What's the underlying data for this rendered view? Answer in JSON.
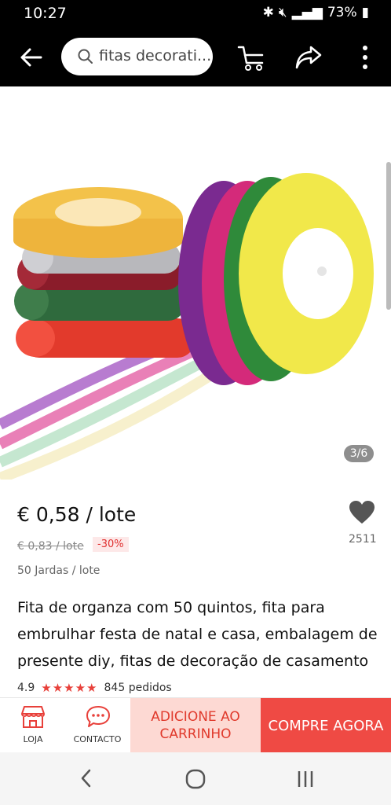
{
  "status": {
    "time": "10:27",
    "battery": "73%"
  },
  "search": {
    "query": "fitas decorati..."
  },
  "icons": {
    "back": "arrow-left-icon",
    "search": "search-icon",
    "cart": "cart-icon",
    "share": "share-icon",
    "more": "more-vertical-icon",
    "wishlist": "heart-icon",
    "store": "store-icon",
    "chat": "chat-icon"
  },
  "gallery": {
    "counter": "3/6"
  },
  "product": {
    "price": "€ 0,58 / lote",
    "old_price": "€ 0,83 / lote",
    "discount": "-30%",
    "wishlist_count": "2511",
    "unit": "50 Jardas / lote",
    "title": "Fita de organza com 50 quintos, fita para embrulhar festa de natal e casa, embalagem de presente diy, fitas de decoração de casamento",
    "rating": "4.9",
    "stars": "★★★★★",
    "orders": "845 pedidos"
  },
  "actions": {
    "store": "LOJA",
    "contact": "CONTACTO",
    "add_to_cart": "ADICIONE AO CARRINHO",
    "buy_now": "COMPRE AGORA"
  },
  "colors": {
    "accent": "#ef4a44",
    "accent_light": "#fdd9d3",
    "star": "#e8403a"
  }
}
